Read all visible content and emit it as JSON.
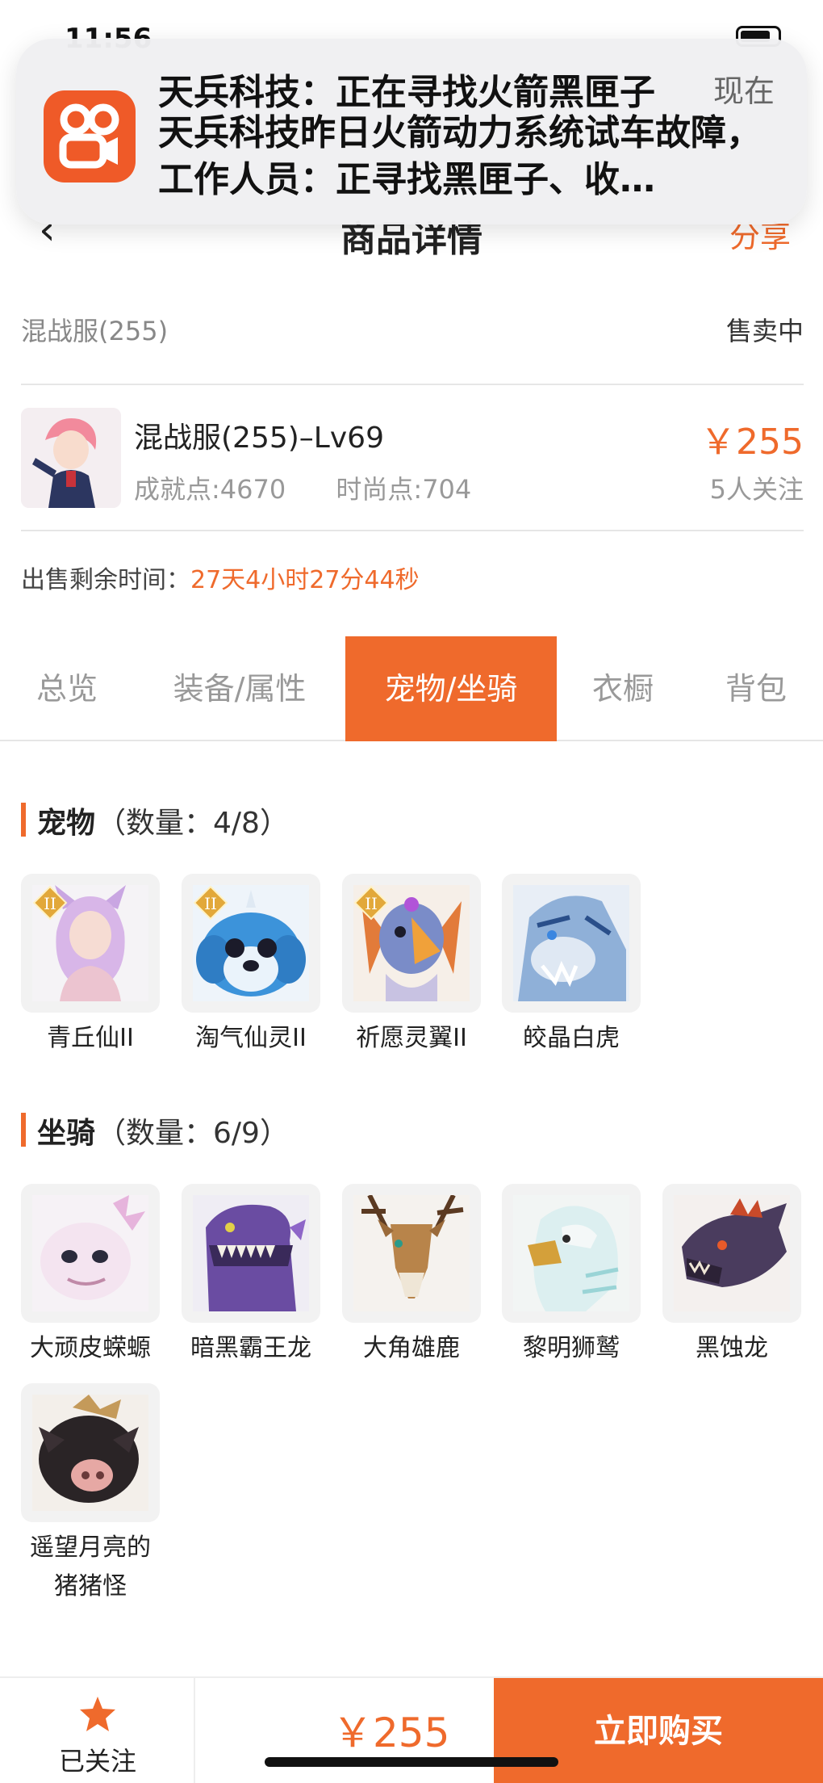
{
  "status_bar": {
    "time": "11:56"
  },
  "notification": {
    "title": "天兵科技：正在寻找火箭黑匣子",
    "time": "现在",
    "body": "天兵科技昨日火箭动力系统试车故障，工作人员：正寻找黑匣子、收…"
  },
  "nav": {
    "title": "商品详情",
    "share": "分享"
  },
  "server": {
    "name": "混战服(255)",
    "status": "售卖中"
  },
  "product": {
    "name": "混战服(255)–Lv69",
    "achievement": "成就点:4670",
    "fashion": "时尚点:704",
    "price": "￥255",
    "followers": "5人关注"
  },
  "remaining": {
    "label": "出售剩余时间：",
    "value": "27天4小时27分44秒"
  },
  "tabs": [
    {
      "label": "总览"
    },
    {
      "label": "装备/属性"
    },
    {
      "label": "宠物/坐骑"
    },
    {
      "label": "衣橱"
    },
    {
      "label": "背包"
    }
  ],
  "pets": {
    "title": "宠物",
    "count": "（数量：4/8）",
    "items": [
      {
        "name": "青丘仙II"
      },
      {
        "name": "淘气仙灵II"
      },
      {
        "name": "祈愿灵翼II"
      },
      {
        "name": "皎晶白虎"
      }
    ]
  },
  "mounts": {
    "title": "坐骑",
    "count": "（数量：6/9）",
    "items": [
      {
        "name": "大顽皮蝾螈"
      },
      {
        "name": "暗黑霸王龙"
      },
      {
        "name": "大角雄鹿"
      },
      {
        "name": "黎明狮鹫"
      },
      {
        "name": "黑蚀龙"
      },
      {
        "name": "遥望月亮的猪猪怪"
      }
    ]
  },
  "bottom": {
    "follow_label": "已关注",
    "price": "￥255",
    "buy_label": "立即购买"
  },
  "colors": {
    "accent": "#ef6a2c"
  }
}
